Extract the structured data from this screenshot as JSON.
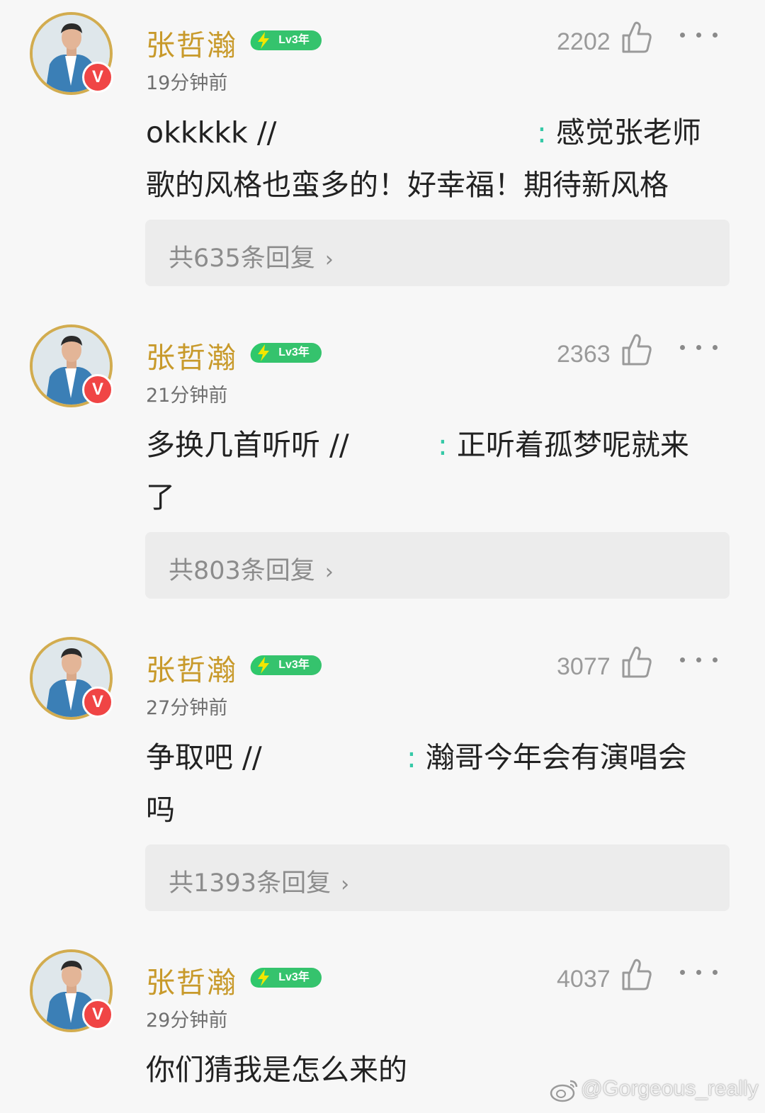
{
  "comments": [
    {
      "name": "张哲瀚",
      "level": "Lv3年",
      "time": "19分钟前",
      "likes": "2202",
      "text_lines": [
        "okkkkk //",
        "歌的风格也蛮多的！好幸福！期待新风格"
      ],
      "quote_colon": ":",
      "quote_first": "感觉张老师",
      "replies": "共635条回复"
    },
    {
      "name": "张哲瀚",
      "level": "Lv3年",
      "time": "21分钟前",
      "likes": "2363",
      "text_lines": [
        "多换几首听听 //",
        "了"
      ],
      "quote_colon": ":",
      "quote_first": "正听着孤梦呢就来",
      "replies": "共803条回复"
    },
    {
      "name": "张哲瀚",
      "level": "Lv3年",
      "time": "27分钟前",
      "likes": "3077",
      "text_lines": [
        "争取吧 //",
        "吗"
      ],
      "quote_colon": ":",
      "quote_first": "瀚哥今年会有演唱会",
      "replies": "共1393条回复"
    },
    {
      "name": "张哲瀚",
      "level": "Lv3年",
      "time": "29分钟前",
      "likes": "4037",
      "text_lines": [
        "你们猜我是怎么来的"
      ]
    }
  ],
  "verified_badge": "V",
  "chevron": "›",
  "watermark": "@Gorgeous_really",
  "colors": {
    "name": "#c89a2b",
    "level_pill": "#35c36d",
    "quote_colon": "#36c9a7",
    "verified_badge": "#f04545",
    "avatar_ring": "#d2ac4f"
  },
  "icons": [
    "thumbs-up-icon",
    "more-dots-icon",
    "lightning-icon",
    "verified-v-icon",
    "weibo-icon"
  ]
}
